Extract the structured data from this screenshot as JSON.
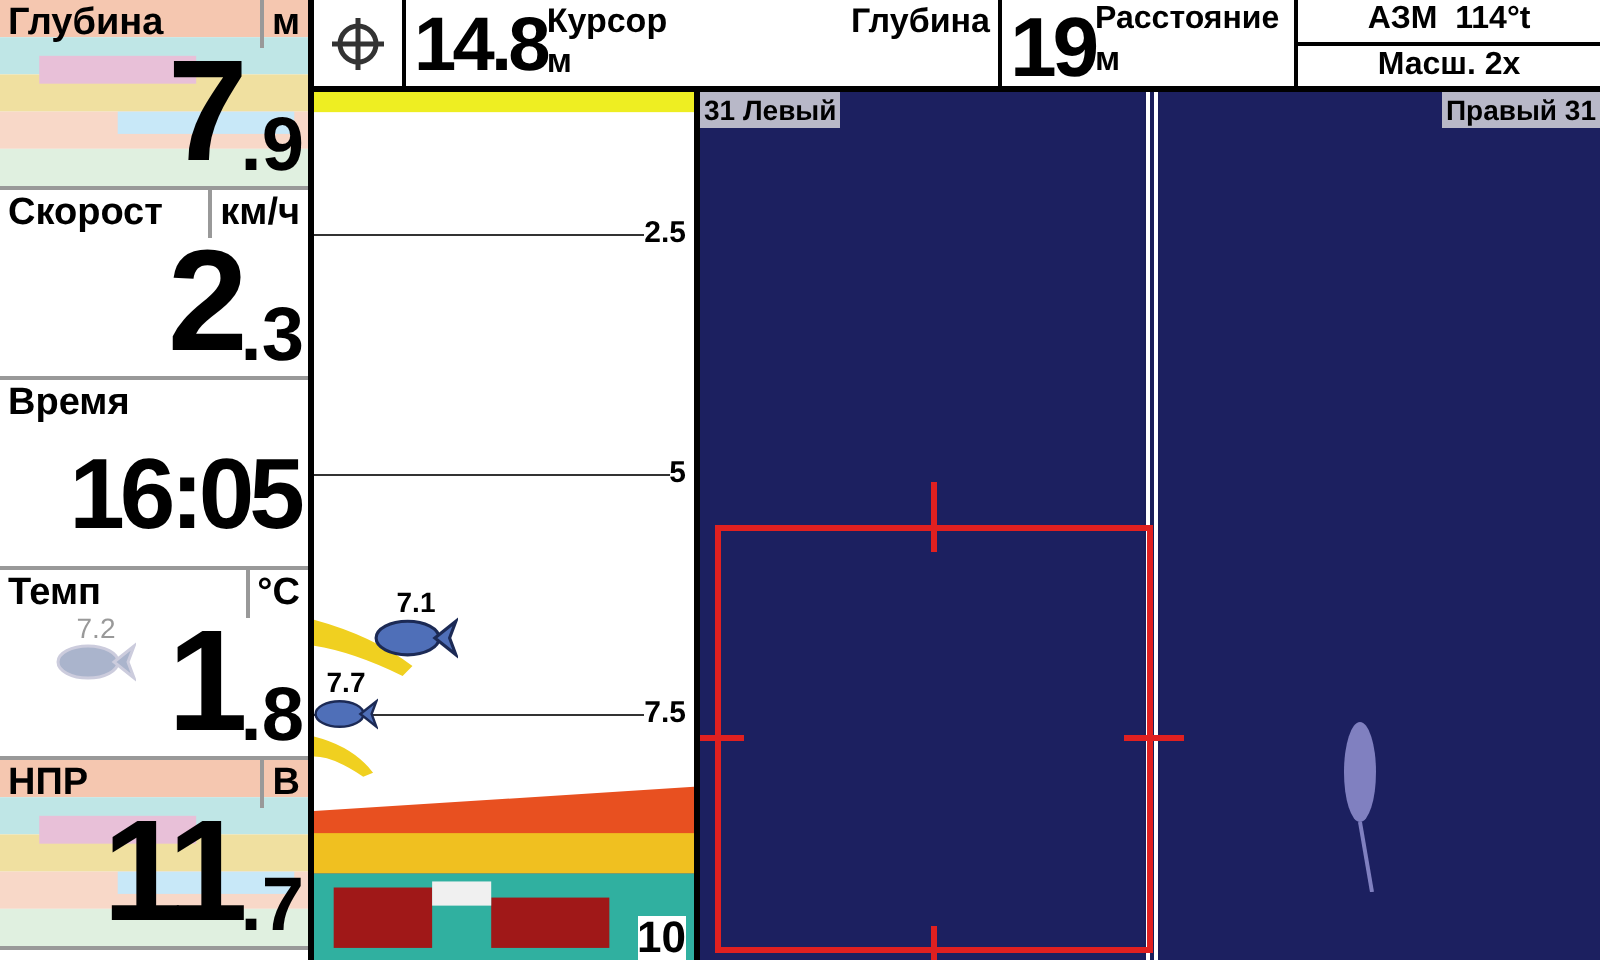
{
  "left_panels": [
    {
      "kind": "split",
      "label": "Глубина",
      "unit": "м",
      "value": "7",
      "decimal": ".9"
    },
    {
      "kind": "split",
      "label": "Скорост",
      "unit": "км/ч",
      "value": "2",
      "decimal": ".3"
    },
    {
      "kind": "time",
      "label": "Время",
      "value": "16:05"
    },
    {
      "kind": "split",
      "label": "Темп",
      "unit": "°C",
      "value": "1",
      "decimal": ".8",
      "fish": "7.2"
    },
    {
      "kind": "split",
      "label": "НПР",
      "unit": "В",
      "value": "11",
      "decimal": ".7"
    }
  ],
  "top_bar": {
    "cursor_value": "14.8",
    "cursor_label": "Курсор",
    "cursor_unit": "м",
    "depth_label": "Глубина",
    "distance_value": "19",
    "distance_label": "Расстояние",
    "distance_unit": "м",
    "heading": "АЗМ  114°t",
    "zoom": "Масш. 2x"
  },
  "sonar": {
    "depth_marks": [
      "2.5",
      "5",
      "7.5"
    ],
    "bottom_depth": "10",
    "fish": [
      {
        "depth": "7.1"
      },
      {
        "depth": "7.7"
      }
    ]
  },
  "side_imaging": {
    "left_label": "31 Левый",
    "right_label": "Правый 31"
  }
}
